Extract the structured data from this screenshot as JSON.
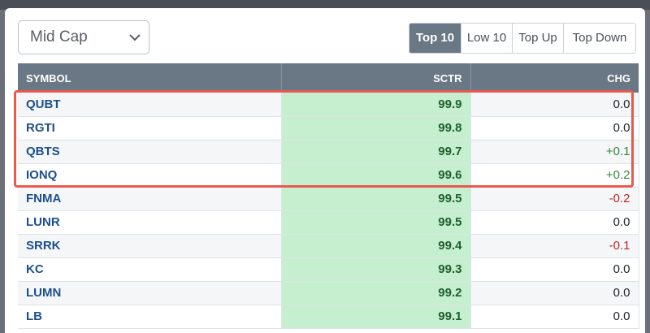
{
  "filter": {
    "selected": "Mid Cap"
  },
  "tabs": [
    {
      "label": "Top 10",
      "active": true
    },
    {
      "label": "Low 10",
      "active": false
    },
    {
      "label": "Top Up",
      "active": false
    },
    {
      "label": "Top Down",
      "active": false
    }
  ],
  "table": {
    "headers": {
      "symbol": "SYMBOL",
      "sctr": "SCTR",
      "chg": "CHG"
    },
    "rows": [
      {
        "symbol": "QUBT",
        "sctr": "99.9",
        "chg": "0.0"
      },
      {
        "symbol": "RGTI",
        "sctr": "99.8",
        "chg": "0.0"
      },
      {
        "symbol": "QBTS",
        "sctr": "99.7",
        "chg": "+0.1"
      },
      {
        "symbol": "IONQ",
        "sctr": "99.6",
        "chg": "+0.2"
      },
      {
        "symbol": "FNMA",
        "sctr": "99.5",
        "chg": "-0.2"
      },
      {
        "symbol": "LUNR",
        "sctr": "99.5",
        "chg": "0.0"
      },
      {
        "symbol": "SRRK",
        "sctr": "99.4",
        "chg": "-0.1"
      },
      {
        "symbol": "KC",
        "sctr": "99.3",
        "chg": "0.0"
      },
      {
        "symbol": "LUMN",
        "sctr": "99.2",
        "chg": "0.0"
      },
      {
        "symbol": "LB",
        "sctr": "99.1",
        "chg": "0.0"
      }
    ]
  },
  "colors": {
    "header_bg": "#6a7785",
    "sctr_bg": "#c6efcf",
    "positive": "#2f8a3b",
    "negative": "#c02626",
    "highlight": "#e85a4f"
  }
}
